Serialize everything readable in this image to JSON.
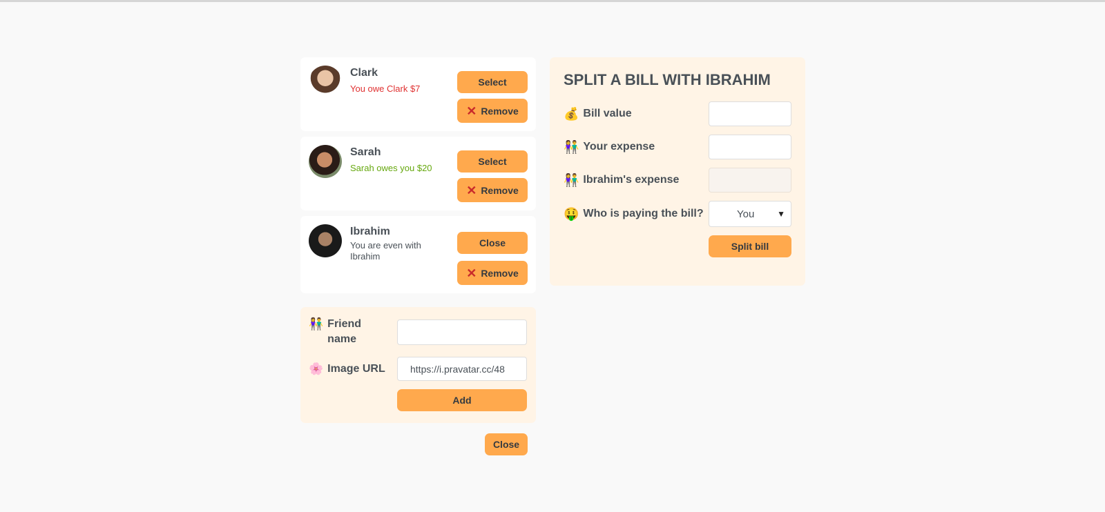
{
  "friends": [
    {
      "name": "Clark",
      "status": "You owe Clark $7",
      "status_color": "#e03131",
      "select_label": "Select",
      "remove_label": "Remove"
    },
    {
      "name": "Sarah",
      "status": "Sarah owes you $20",
      "status_color": "#66a80f",
      "select_label": "Select",
      "remove_label": "Remove"
    },
    {
      "name": "Ibrahim",
      "status": "You are even with Ibrahim",
      "status_color": "#495057",
      "select_label": "Close",
      "remove_label": "Remove"
    }
  ],
  "add_form": {
    "name_label": "Friend name",
    "name_value": "",
    "image_label": "Image URL",
    "image_value": "https://i.pravatar.cc/48",
    "add_label": "Add",
    "name_icon": "people-icon",
    "image_icon": "flower-icon"
  },
  "close_label": "Close",
  "split": {
    "title": "SPLIT A BILL WITH IBRAHIM",
    "bill_label": "Bill value",
    "bill_value": "",
    "expense_label": "Your expense",
    "expense_value": "",
    "friend_expense_label": "Ibrahim's expense",
    "friend_expense_value": "",
    "payer_label": "Who is paying the bill?",
    "payer_value": "You",
    "submit_label": "Split bill"
  },
  "colors": {
    "accent": "#ffa94d",
    "panel": "#fff4e6",
    "owe": "#e03131",
    "owed": "#66a80f"
  }
}
